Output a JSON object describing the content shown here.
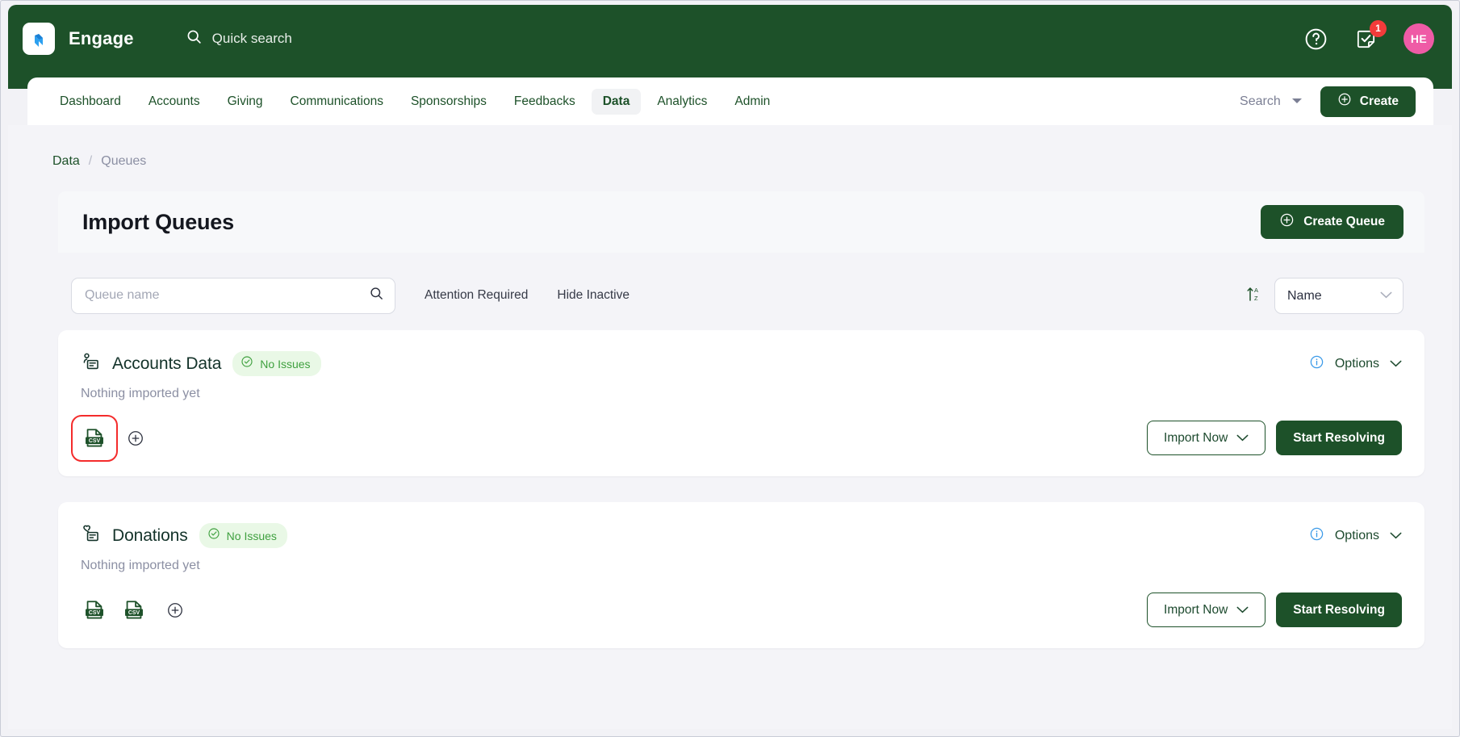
{
  "header": {
    "brand": "Engage",
    "logo_icon": "engage-logo-icon",
    "quick_search": {
      "label": "Quick search",
      "icon": "search-icon"
    },
    "help_icon": "help-circle-icon",
    "tasks_icon": "task-checkbox-icon",
    "tasks_badge": "1",
    "avatar_initials": "HE",
    "accent_color": "#1d5129",
    "avatar_color": "#ef5ba6",
    "badge_color": "#f33b3b"
  },
  "nav": {
    "items": [
      {
        "label": "Dashboard",
        "active": false
      },
      {
        "label": "Accounts",
        "active": false
      },
      {
        "label": "Giving",
        "active": false
      },
      {
        "label": "Communications",
        "active": false
      },
      {
        "label": "Sponsorships",
        "active": false
      },
      {
        "label": "Feedbacks",
        "active": false
      },
      {
        "label": "Data",
        "active": true
      },
      {
        "label": "Analytics",
        "active": false
      },
      {
        "label": "Admin",
        "active": false
      }
    ],
    "search_label": "Search",
    "search_chevron_icon": "chevron-down-icon",
    "create_label": "Create",
    "create_icon": "plus-circle-icon"
  },
  "breadcrumb": {
    "parent": "Data",
    "separator": "/",
    "current": "Queues"
  },
  "page": {
    "title": "Import Queues",
    "create_queue_label": "Create Queue",
    "create_queue_icon": "plus-circle-icon"
  },
  "filters": {
    "search_placeholder": "Queue name",
    "search_value": "",
    "search_icon": "search-icon",
    "attention_required_label": "Attention Required",
    "hide_inactive_label": "Hide Inactive",
    "sort_icon": "sort-alpha-ascending-icon",
    "sort_value": "Name",
    "sort_options": [
      "Name"
    ],
    "sort_chevron_icon": "chevron-down-icon"
  },
  "queues": [
    {
      "name": "Accounts Data",
      "type_icon": "person-record-icon",
      "status_label": "No Issues",
      "status_icon": "check-circle-icon",
      "status_color": "#3fa03f",
      "status_bg": "#e9f8e6",
      "subtitle": "Nothing imported yet",
      "info_icon": "info-circle-icon",
      "options_label": "Options",
      "options_chevron_icon": "chevron-down-icon",
      "files": [
        {
          "icon": "csv-file-icon",
          "highlighted": true
        }
      ],
      "add_file_icon": "plus-circle-icon",
      "import_label": "Import Now",
      "import_chevron_icon": "chevron-down-icon",
      "resolve_label": "Start Resolving"
    },
    {
      "name": "Donations",
      "type_icon": "heart-record-icon",
      "status_label": "No Issues",
      "status_icon": "check-circle-icon",
      "status_color": "#3fa03f",
      "status_bg": "#e9f8e6",
      "subtitle": "Nothing imported yet",
      "info_icon": "info-circle-icon",
      "options_label": "Options",
      "options_chevron_icon": "chevron-down-icon",
      "files": [
        {
          "icon": "csv-file-icon",
          "highlighted": false
        },
        {
          "icon": "csv-file-icon",
          "highlighted": false
        }
      ],
      "add_file_icon": "plus-circle-icon",
      "import_label": "Import Now",
      "import_chevron_icon": "chevron-down-icon",
      "resolve_label": "Start Resolving"
    }
  ]
}
